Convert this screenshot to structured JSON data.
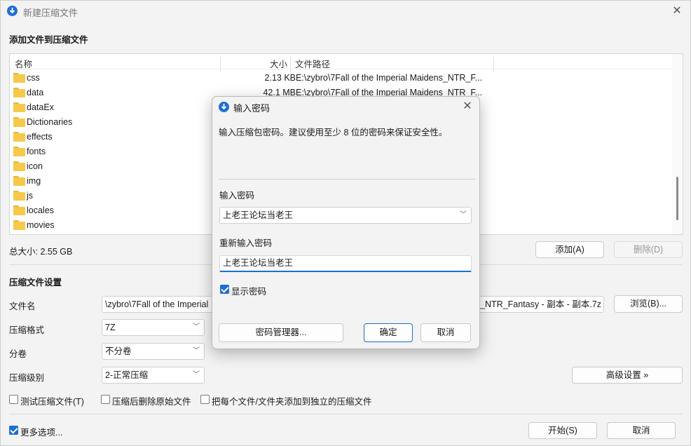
{
  "window": {
    "title": "新建压缩文件",
    "close": "✕"
  },
  "files_section": {
    "title": "添加文件到压缩文件",
    "columns": [
      "名称",
      "大小",
      "文件路径"
    ],
    "rows": [
      {
        "name": "css",
        "size": "2.13 KB",
        "path": "E:\\zybro\\7Fall of the Imperial Maidens_NTR_F..."
      },
      {
        "name": "data",
        "size": "42.1 MB",
        "path": "E:\\zybro\\7Fall of the Imperial Maidens_NTR_F..."
      },
      {
        "name": "dataEx",
        "size": "",
        "path": "..."
      },
      {
        "name": "Dictionaries",
        "size": "",
        "path": "..."
      },
      {
        "name": "effects",
        "size": "",
        "path": "..."
      },
      {
        "name": "fonts",
        "size": "",
        "path": "..."
      },
      {
        "name": "icon",
        "size": "",
        "path": "..."
      },
      {
        "name": "img",
        "size": "",
        "path": "..."
      },
      {
        "name": "js",
        "size": "",
        "path": "..."
      },
      {
        "name": "locales",
        "size": "",
        "path": "..."
      },
      {
        "name": "movies",
        "size": "",
        "path": "..."
      }
    ],
    "total_size": "总大小: 2.55 GB",
    "add_label": "添加(A)",
    "delete_label": "删除(D)"
  },
  "settings": {
    "title": "压缩文件设置",
    "filename_label": "文件名",
    "filename_value_left": "\\zybro\\7Fall of the Imperial",
    "filename_value_right": "s_NTR_Fantasy - 副本 - 副本.7z",
    "browse_label": "浏览(B)...",
    "format_label": "压缩格式",
    "format_value": "7Z",
    "split_label": "分卷",
    "split_value": "不分卷",
    "level_label": "压缩级别",
    "level_value": "2-正常压缩",
    "advanced_label": "高级设置 »",
    "test_label": "测试压缩文件(T)",
    "delete_src_label": "压缩后删除原始文件",
    "separate_label": "把每个文件/文件夹添加到独立的压缩文件"
  },
  "footer": {
    "more_label": "更多选项...",
    "start_label": "开始(S)",
    "cancel_label": "取消"
  },
  "dialog": {
    "title": "输入密码",
    "hint": "输入压缩包密码。建议使用至少 8 位的密码来保证安全性。",
    "password_label": "输入密码",
    "password_value": "上老王论坛当老王",
    "repeat_label": "重新输入密码",
    "repeat_value": "上老王论坛当老王",
    "show_password_label": "显示密码",
    "manager_label": "密码管理器...",
    "ok_label": "确定",
    "cancel_label": "取消"
  },
  "colors": {
    "accent": "#1c6fd0",
    "folder": "#f6c94b"
  }
}
